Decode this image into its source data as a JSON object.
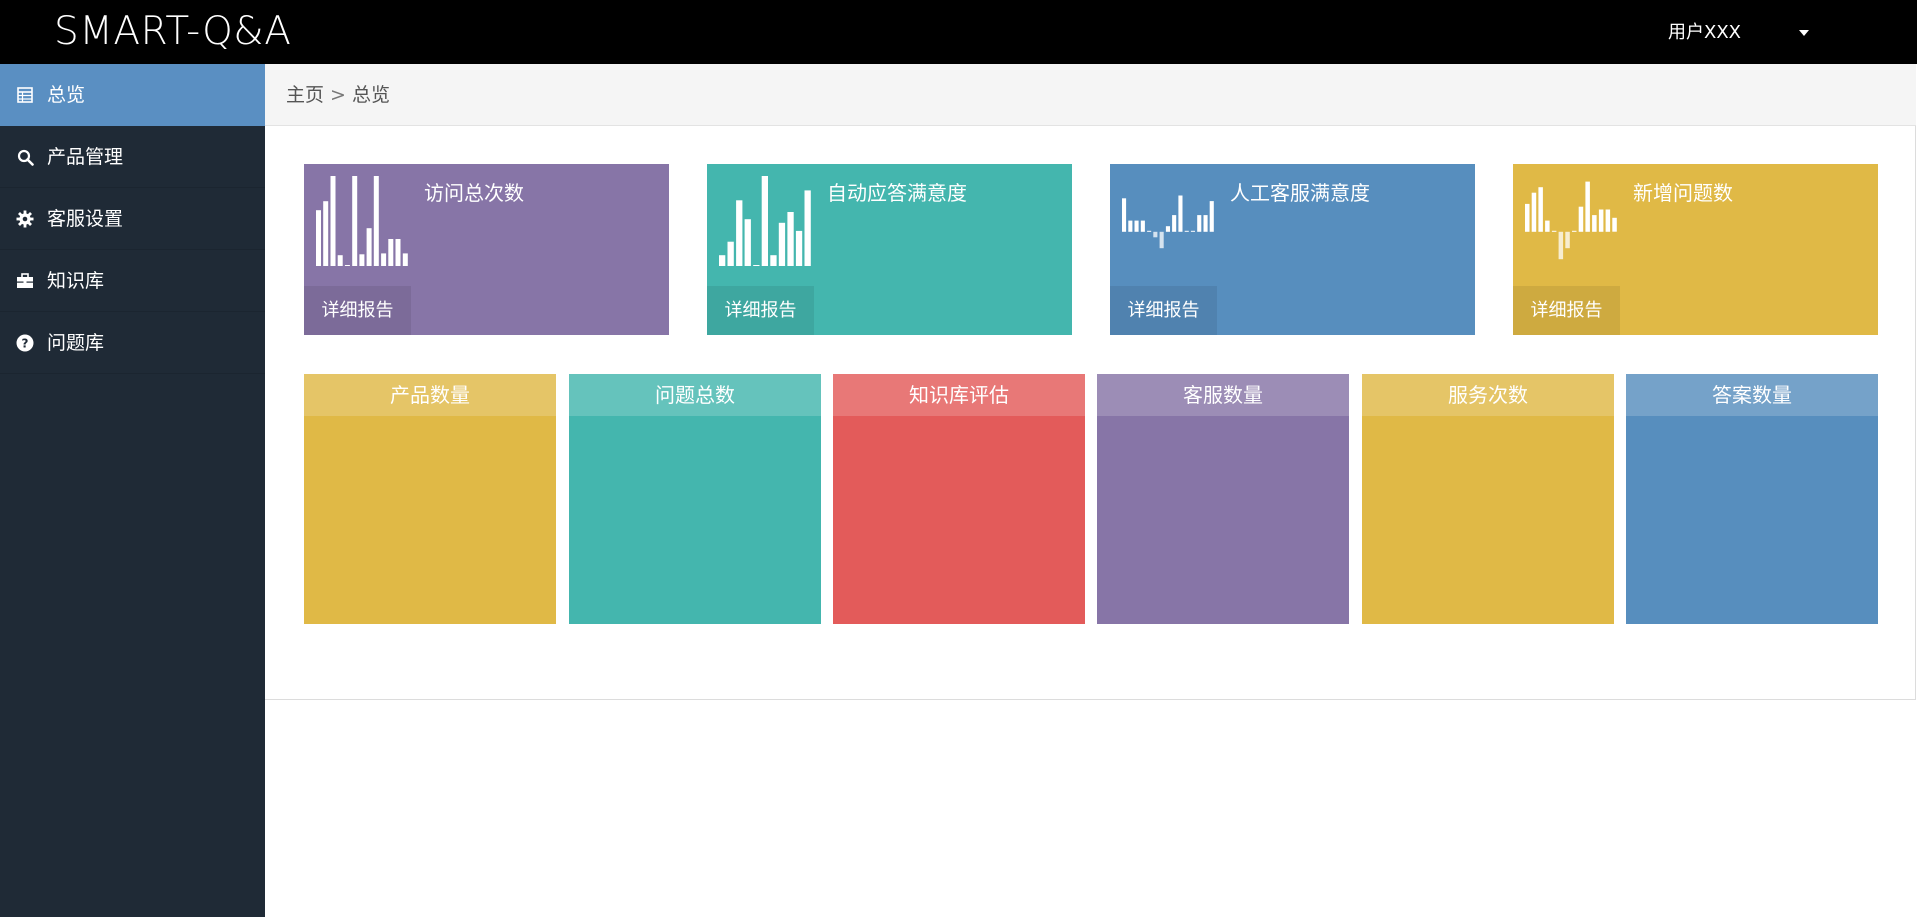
{
  "app": {
    "brand": "SMART-Q&A"
  },
  "user": {
    "name": "用户XXX"
  },
  "sidebar": {
    "items": [
      {
        "label": "总览",
        "icon": "table-icon",
        "active": true
      },
      {
        "label": "产品管理",
        "icon": "search-icon",
        "active": false
      },
      {
        "label": "客服设置",
        "icon": "gear-icon",
        "active": false
      },
      {
        "label": "知识库",
        "icon": "briefcase-icon",
        "active": false
      },
      {
        "label": "问题库",
        "icon": "question-circle-icon",
        "active": false
      }
    ]
  },
  "breadcrumb": {
    "home": "主页",
    "separator": ">",
    "current": "总览"
  },
  "stat_cards": [
    {
      "title": "访问总次数",
      "link": "详细报告",
      "color": "#8775a7",
      "spark": [
        0.62,
        0.72,
        1.0,
        0.12,
        0.0,
        1.0,
        0.13,
        0.42,
        1.0,
        0.14,
        0.3,
        0.3,
        0.14
      ]
    },
    {
      "title": "自动应答满意度",
      "link": "详细报告",
      "color": "#44b6ae",
      "spark": [
        0.12,
        0.27,
        0.73,
        0.52,
        0.01,
        1.0,
        0.12,
        0.48,
        0.6,
        0.39,
        0.84
      ]
    },
    {
      "title": "人工客服满意度",
      "link": "详细报告",
      "color": "#578ebe",
      "spark": [
        0.6,
        0.2,
        0.2,
        0.2,
        0.0,
        -0.1,
        -0.3,
        0.1,
        0.3,
        0.65,
        0.0,
        0.0,
        0.3,
        0.3,
        0.55
      ]
    },
    {
      "title": "新增问题数",
      "link": "详细报告",
      "color": "#e0b946",
      "spark": [
        0.5,
        0.7,
        0.8,
        0.2,
        0.0,
        -0.5,
        -0.3,
        0.0,
        0.45,
        0.9,
        0.3,
        0.4,
        0.4,
        0.25
      ]
    }
  ],
  "tiles": [
    {
      "label": "产品数量",
      "value": "",
      "color": "#e0b946"
    },
    {
      "label": "问题总数",
      "value": "",
      "color": "#44b6ae"
    },
    {
      "label": "知识库评估",
      "value": "",
      "color": "#e35b5a"
    },
    {
      "label": "客服数量",
      "value": "",
      "color": "#8775a7"
    },
    {
      "label": "服务次数",
      "value": "",
      "color": "#e0b946"
    },
    {
      "label": "答案数量",
      "value": "",
      "color": "#578ebe"
    }
  ],
  "colors": {
    "topbar": "#000000",
    "sidebar": "#1f2a36",
    "sidebar_active": "#5a8fc2"
  }
}
